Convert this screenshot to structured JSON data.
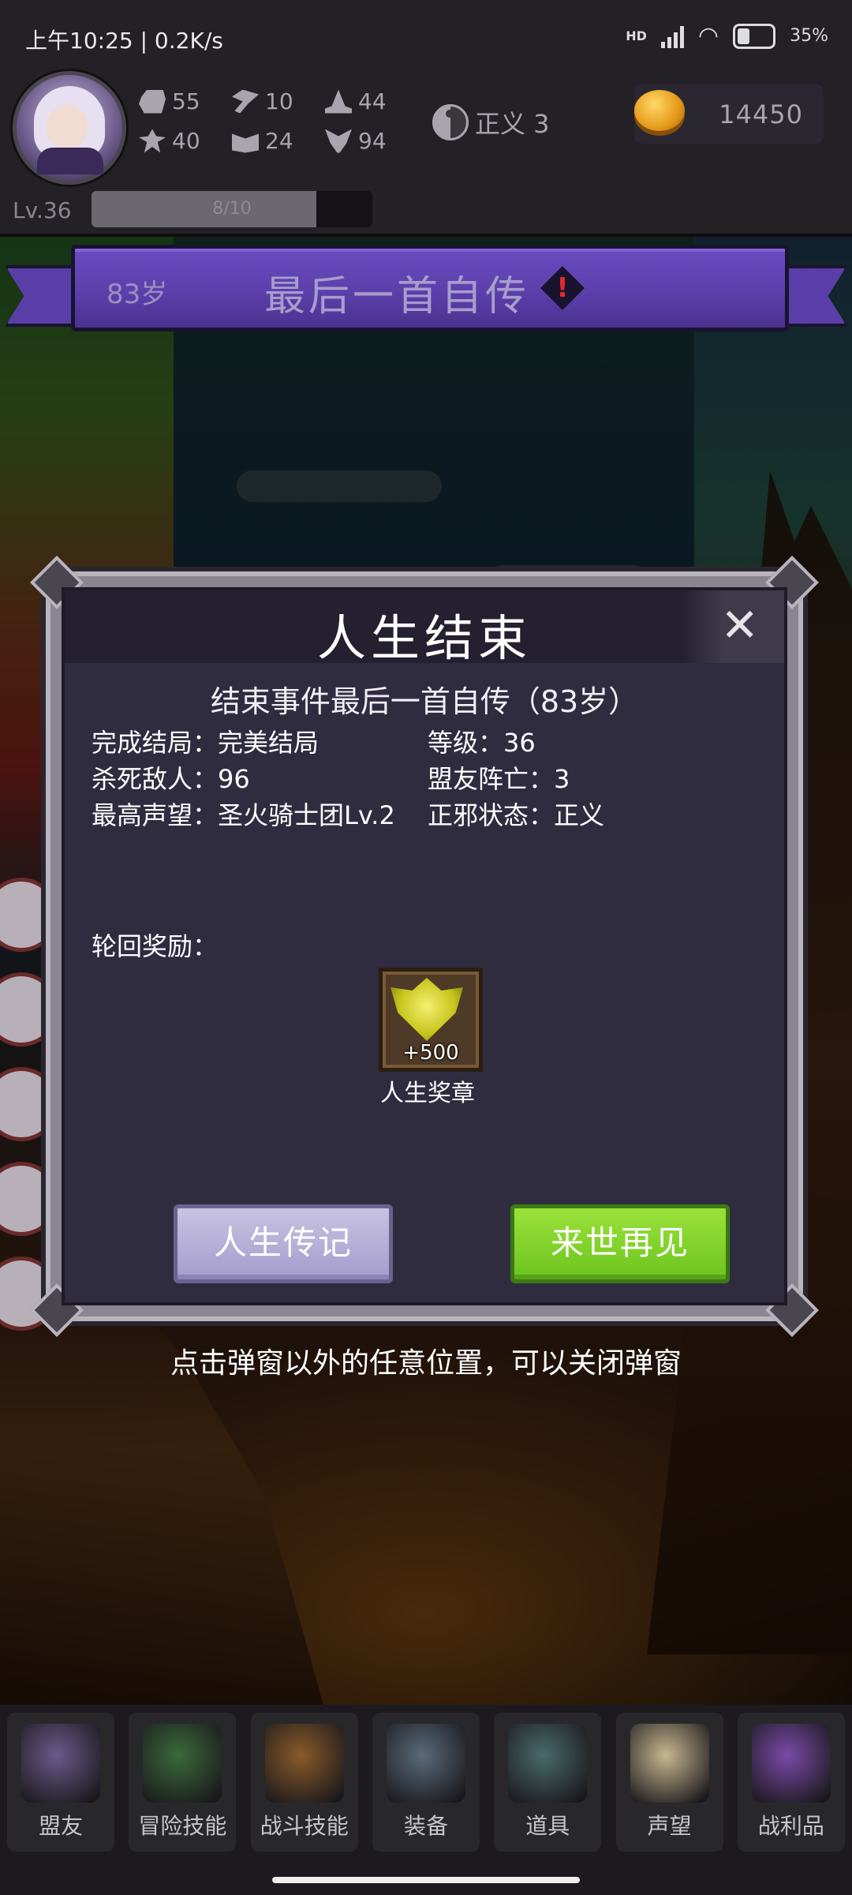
{
  "status_bar": {
    "time": "上午10:25 | 0.2K/s",
    "network": "HD",
    "battery": "35%",
    "battery_level": 0.35
  },
  "player": {
    "stats": [
      {
        "icon": "fist-icon",
        "value": "55"
      },
      {
        "icon": "axe-icon",
        "value": "10"
      },
      {
        "icon": "witch-hat-icon",
        "value": "44"
      },
      {
        "icon": "clover-icon",
        "value": "40"
      },
      {
        "icon": "book-icon",
        "value": "24"
      },
      {
        "icon": "wings-icon",
        "value": "94"
      }
    ],
    "karma_label": "正义 3",
    "gold": "14450",
    "level": "Lv.36",
    "xp_text": "8/10",
    "xp_fraction": 0.8
  },
  "event_banner": {
    "age": "83岁",
    "title": "最后一首自传",
    "alert": "!"
  },
  "modal": {
    "title": "人生结束",
    "close_glyph": "✕",
    "event_line": "结束事件最后一首自传（83岁）",
    "info": [
      {
        "label": "完成结局：",
        "value": "完美结局"
      },
      {
        "label": "等级：",
        "value": "36"
      },
      {
        "label": "杀死敌人：",
        "value": "96"
      },
      {
        "label": "盟友阵亡：",
        "value": "3"
      },
      {
        "label": "最高声望：",
        "value": "圣火骑士团Lv.2"
      },
      {
        "label": "正邪状态：",
        "value": "正义"
      }
    ],
    "reward_label": "轮回奖励：",
    "reward": {
      "icon": "medal-icon",
      "qty": "+500",
      "name": "人生奖章"
    },
    "btn_biography": "人生传记",
    "btn_next_life": "来世再见"
  },
  "close_hint": "点击弹窗以外的任意位置，可以关闭弹窗",
  "nav": [
    {
      "label": "盟友",
      "icon": "handshake-icon",
      "color": "#6a5a8a"
    },
    {
      "label": "冒险技能",
      "icon": "green-book-icon",
      "color": "#3a6a3a"
    },
    {
      "label": "战斗技能",
      "icon": "backpack-icon",
      "color": "#8a5a2a"
    },
    {
      "label": "装备",
      "icon": "crossed-swords-icon",
      "color": "#5a6a7a"
    },
    {
      "label": "道具",
      "icon": "pouch-icon",
      "color": "#4a6a6a"
    },
    {
      "label": "声望",
      "icon": "scroll-icon",
      "color": "#c8b890"
    },
    {
      "label": "战利品",
      "icon": "treasure-chest-icon",
      "color": "#7a4aa8"
    }
  ]
}
